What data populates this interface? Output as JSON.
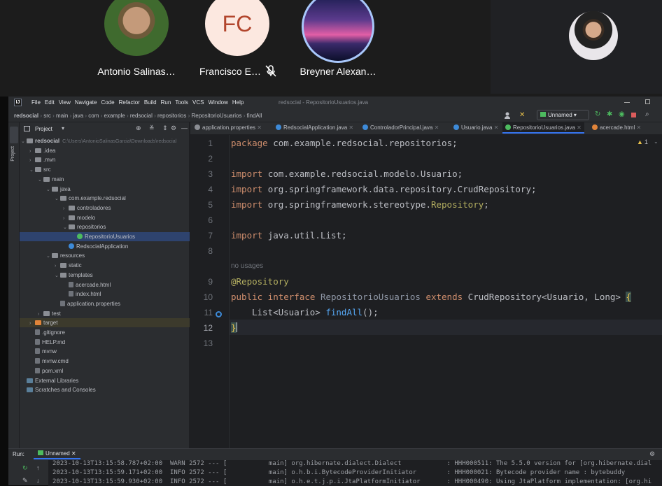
{
  "meet": {
    "participants": [
      {
        "name": "Antonio Salinas…",
        "initials": ""
      },
      {
        "name": "Francisco E…",
        "initials": "FC"
      },
      {
        "name": "Breyner Alexan…",
        "initials": ""
      }
    ]
  },
  "ide": {
    "menu": [
      "File",
      "Edit",
      "View",
      "Navigate",
      "Code",
      "Refactor",
      "Build",
      "Run",
      "Tools",
      "VCS",
      "Window",
      "Help"
    ],
    "window_title": "redsocial - RepositorioUsuarios.java",
    "breadcrumb": [
      "redsocial",
      "src",
      "main",
      "java",
      "com",
      "example",
      "redsocial",
      "repositorios",
      "RepositorioUsuarios",
      "findAll"
    ],
    "run_config": "Unnamed",
    "project_label": "Project",
    "side_tab": "Project",
    "tabs": [
      "application.properties",
      "RedsocialApplication.java",
      "ControladorPrincipal.java",
      "Usuario.java",
      "RepositorioUsuarios.java",
      "acercade.html"
    ],
    "warning_count": "1",
    "tree": [
      {
        "label": "redsocial",
        "path": "C:\\Users\\AntonioSalinasGarcia\\Downloads\\redsocial",
        "depth": 0,
        "kind": "folder",
        "open": true
      },
      {
        "label": ".idea",
        "depth": 1,
        "kind": "folder"
      },
      {
        "label": ".mvn",
        "depth": 1,
        "kind": "folder"
      },
      {
        "label": "src",
        "depth": 1,
        "kind": "folder",
        "open": true
      },
      {
        "label": "main",
        "depth": 2,
        "kind": "folder",
        "open": true
      },
      {
        "label": "java",
        "depth": 3,
        "kind": "folder",
        "open": true
      },
      {
        "label": "com.example.redsocial",
        "depth": 4,
        "kind": "folder",
        "open": true
      },
      {
        "label": "controladores",
        "depth": 5,
        "kind": "folder"
      },
      {
        "label": "modelo",
        "depth": 5,
        "kind": "folder"
      },
      {
        "label": "repositorios",
        "depth": 5,
        "kind": "folder",
        "open": true
      },
      {
        "label": "RepositorioUsuarios",
        "depth": 6,
        "kind": "interface",
        "selected": true
      },
      {
        "label": "RedsocialApplication",
        "depth": 5,
        "kind": "class"
      },
      {
        "label": "resources",
        "depth": 3,
        "kind": "folder",
        "open": true
      },
      {
        "label": "static",
        "depth": 4,
        "kind": "folder"
      },
      {
        "label": "templates",
        "depth": 4,
        "kind": "folder",
        "open": true
      },
      {
        "label": "acercade.html",
        "depth": 5,
        "kind": "file"
      },
      {
        "label": "index.html",
        "depth": 5,
        "kind": "file"
      },
      {
        "label": "application.properties",
        "depth": 4,
        "kind": "file"
      },
      {
        "label": "test",
        "depth": 2,
        "kind": "folder"
      },
      {
        "label": "target",
        "depth": 1,
        "kind": "folder-orange",
        "highlight": true
      },
      {
        "label": ".gitignore",
        "depth": 1,
        "kind": "file"
      },
      {
        "label": "HELP.md",
        "depth": 1,
        "kind": "file"
      },
      {
        "label": "mvnw",
        "depth": 1,
        "kind": "file"
      },
      {
        "label": "mvnw.cmd",
        "depth": 1,
        "kind": "file"
      },
      {
        "label": "pom.xml",
        "depth": 1,
        "kind": "file"
      },
      {
        "label": "External Libraries",
        "depth": 0,
        "kind": "lib"
      },
      {
        "label": "Scratches and Consoles",
        "depth": 0,
        "kind": "lib"
      }
    ],
    "code": {
      "line1": "package com.example.redsocial.repositorios;",
      "line3": "import com.example.redsocial.modelo.Usuario;",
      "line4": "import org.springframework.data.repository.CrudRepository;",
      "line5": "import org.springframework.stereotype.Repository;",
      "line7": "import java.util.List;",
      "hint": "no usages",
      "line9": "@Repository",
      "line10": "public interface RepositorioUsuarios extends CrudRepository<Usuario, Long> {",
      "line11": "List<Usuario> findAll();",
      "line12": "}"
    },
    "line_numbers": [
      "1",
      "2",
      "3",
      "4",
      "5",
      "6",
      "7",
      "8",
      "9",
      "10",
      "11",
      "12",
      "13"
    ],
    "run": {
      "label": "Run:",
      "tab": "Unnamed",
      "logs": [
        "2023-10-13T13:15:58.787+02:00  WARN 2572 --- [           main] org.hibernate.dialect.Dialect            : HHH000511: The 5.5.0 version for [org.hibernate.dial",
        "2023-10-13T13:15:59.171+02:00  INFO 2572 --- [           main] o.h.b.i.BytecodeProviderInitiator        : HHH000021: Bytecode provider name : bytebuddy",
        "2023-10-13T13:15:59.930+02:00  INFO 2572 --- [           main] o.h.e.t.j.p.i.JtaPlatformInitiator       : HHH000490: Using JtaPlatform implementation: [org.hi"
      ]
    }
  },
  "colors": {
    "ide_bg": "#1e1f22",
    "selection": "#2e436e",
    "accent": "#3574f0",
    "keyword": "#cf8e6d",
    "annotation": "#b3ae60",
    "method": "#56a8f5"
  }
}
